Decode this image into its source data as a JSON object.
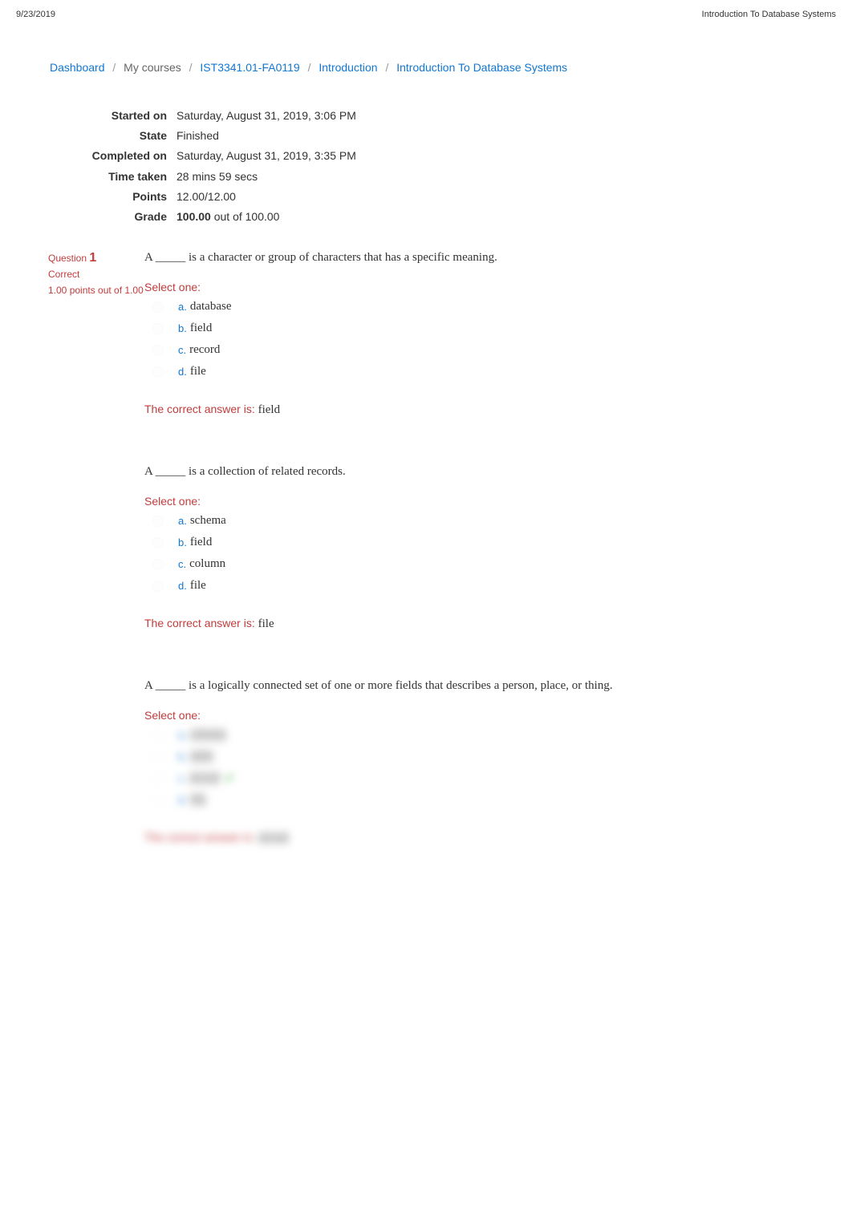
{
  "header": {
    "date": "9/23/2019",
    "title": "Introduction To Database Systems"
  },
  "breadcrumb": {
    "dashboard": "Dashboard",
    "my_courses": "My courses",
    "course": "IST3341.01-FA0119",
    "section": "Introduction",
    "page": "Introduction To Database Systems"
  },
  "summary": {
    "started_on_label": "Started on",
    "started_on_value": "Saturday, August 31, 2019, 3:06 PM",
    "state_label": "State",
    "state_value": "Finished",
    "completed_on_label": "Completed on",
    "completed_on_value": "Saturday, August 31, 2019, 3:35 PM",
    "time_taken_label": "Time taken",
    "time_taken_value": "28 mins 59 secs",
    "points_label": "Points",
    "points_value": "12.00/12.00",
    "grade_label": "Grade",
    "grade_value_bold": "100.00",
    "grade_value_rest": " out of 100.00"
  },
  "questions": [
    {
      "qnum_label": "Question",
      "qnum": "1",
      "status": "Correct",
      "points": "1.00 points out of 1.00",
      "text": "A _____ is a character or group of characters that has a specific meaning.",
      "select_label": "Select one:",
      "options": [
        {
          "letter": "a.",
          "text": "database"
        },
        {
          "letter": "b.",
          "text": "field"
        },
        {
          "letter": "c.",
          "text": "record"
        },
        {
          "letter": "d.",
          "text": "file"
        }
      ],
      "correct_label": "The correct answer is: ",
      "correct_value": "field",
      "blurred_meta": false,
      "blurred_answer": false
    },
    {
      "qnum_label": "",
      "qnum": "",
      "status": "",
      "points": "",
      "text": "A _____ is a collection of related records.",
      "select_label": "Select one:",
      "options": [
        {
          "letter": "a.",
          "text": "schema"
        },
        {
          "letter": "b.",
          "text": "field"
        },
        {
          "letter": "c.",
          "text": "column"
        },
        {
          "letter": "d.",
          "text": "file"
        }
      ],
      "correct_label": "The correct answer is: ",
      "correct_value": "file",
      "blurred_meta": true,
      "blurred_answer": false
    },
    {
      "qnum_label": "",
      "qnum": "",
      "status": "",
      "points": "",
      "text": "A _____ is a logically connected set of one or more fields that describes a person, place, or thing.",
      "select_label": "Select one:",
      "options": [
        {
          "letter": "a.",
          "text": "schema"
        },
        {
          "letter": "b.",
          "text": "table"
        },
        {
          "letter": "c.",
          "text": "record",
          "checked": true
        },
        {
          "letter": "d.",
          "text": "file"
        }
      ],
      "correct_label": "The correct answer is: ",
      "correct_value": "record",
      "blurred_meta": true,
      "blurred_answer": true
    }
  ]
}
